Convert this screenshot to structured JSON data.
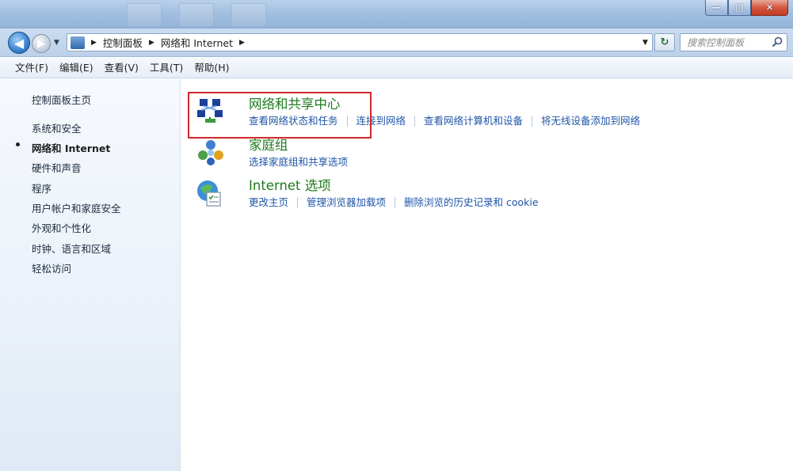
{
  "window": {
    "minimize_glyph": "—",
    "maximize_glyph": "□",
    "close_glyph": "✕"
  },
  "address_bar": {
    "breadcrumbs": [
      "控制面板",
      "网络和 Internet"
    ],
    "search_placeholder": "搜索控制面板"
  },
  "menu": [
    "文件(F)",
    "编辑(E)",
    "查看(V)",
    "工具(T)",
    "帮助(H)"
  ],
  "sidebar": {
    "home": "控制面板主页",
    "items": [
      "系统和安全",
      "网络和 Internet",
      "硬件和声音",
      "程序",
      "用户帐户和家庭安全",
      "外观和个性化",
      "时钟、语言和区域",
      "轻松访问"
    ],
    "active_index": 1
  },
  "categories": [
    {
      "title": "网络和共享中心",
      "icon": "network-sharing-center-icon",
      "tasks": [
        "查看网络状态和任务",
        "连接到网络",
        "查看网络计算机和设备",
        "将无线设备添加到网络"
      ]
    },
    {
      "title": "家庭组",
      "icon": "homegroup-icon",
      "tasks": [
        "选择家庭组和共享选项"
      ]
    },
    {
      "title": "Internet 选项",
      "icon": "internet-options-icon",
      "tasks": [
        "更改主页",
        "管理浏览器加载项",
        "删除浏览的历史记录和 cookie"
      ]
    }
  ],
  "colors": {
    "category_title": "#1e7b1e",
    "task_link": "#1f55a7",
    "highlight_box": "#d2282c"
  }
}
